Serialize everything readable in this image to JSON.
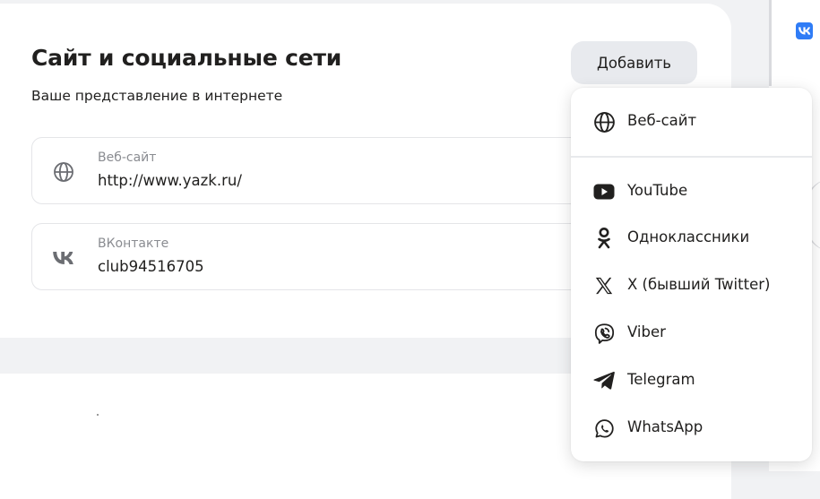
{
  "section": {
    "title": "Сайт и социальные сети",
    "subtitle": "Ваше представление в интернете",
    "add_label": "Добавить"
  },
  "fields": [
    {
      "label": "Веб-сайт",
      "value": "http://www.yazk.ru/",
      "icon": "globe-icon"
    },
    {
      "label": "ВКонтакте",
      "value": "club94516705",
      "icon": "vk-icon"
    }
  ],
  "menu": {
    "items": [
      {
        "label": "Веб-сайт",
        "icon": "globe-icon"
      },
      {
        "label": "YouTube",
        "icon": "youtube-icon"
      },
      {
        "label": "Одноклассники",
        "icon": "odnoklassniki-icon"
      },
      {
        "label": "X (бывший Twitter)",
        "icon": "x-icon"
      },
      {
        "label": "Viber",
        "icon": "viber-icon"
      },
      {
        "label": "Telegram",
        "icon": "telegram-icon"
      },
      {
        "label": "WhatsApp",
        "icon": "whatsapp-icon"
      }
    ]
  },
  "colors": {
    "background": "#f1f2f4",
    "card": "#ffffff",
    "button": "#e8eaee",
    "text": "#21201f",
    "muted": "#8a8c91",
    "vk_brand": "#2f7cf6"
  }
}
